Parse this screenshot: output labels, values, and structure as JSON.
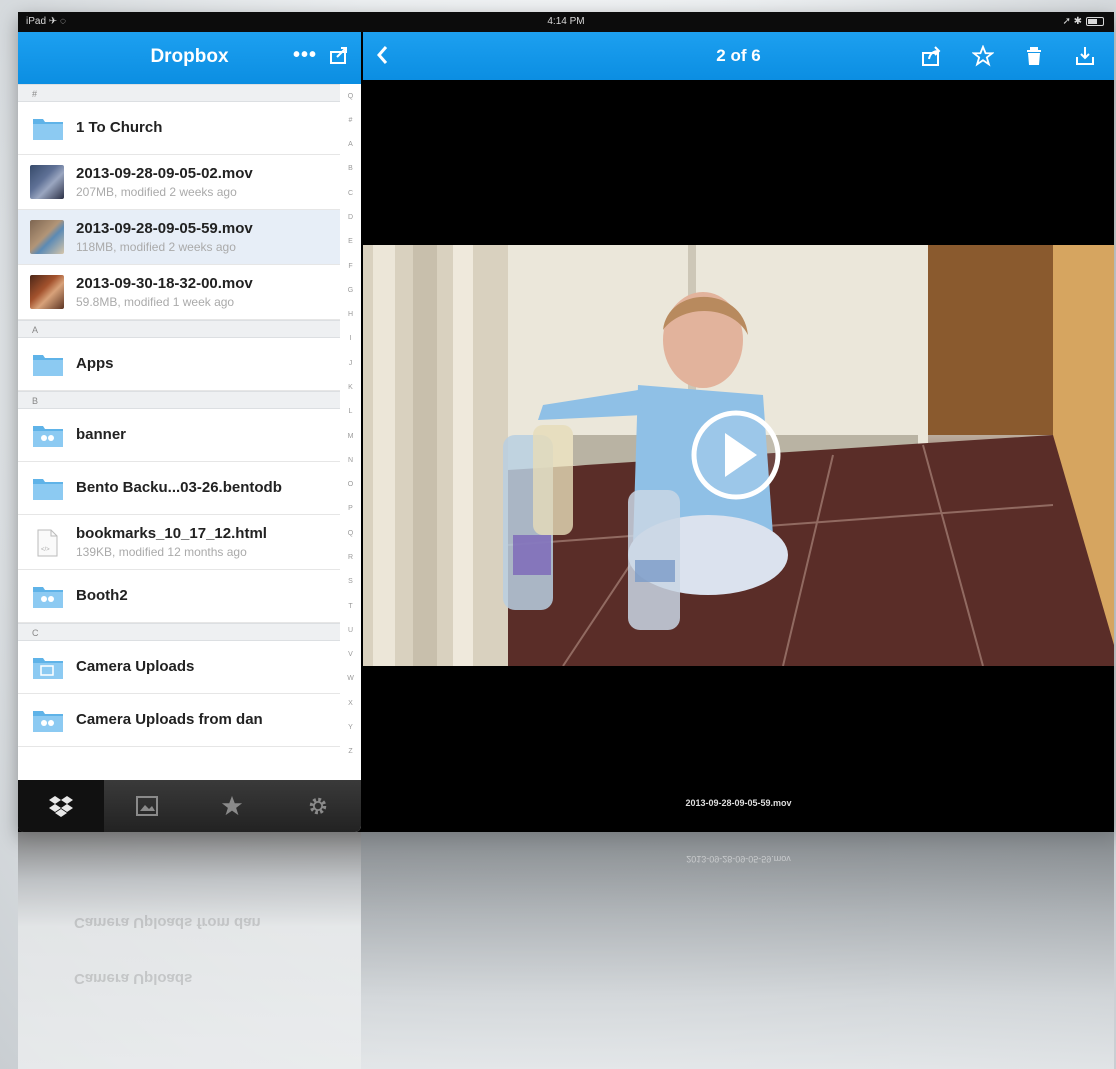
{
  "status_bar": {
    "carrier": "iPad ✈ ◌",
    "time": "4:14 PM",
    "right": "➚ ✱"
  },
  "sidebar": {
    "title": "Dropbox",
    "more_label": "•••",
    "sections": [
      {
        "header": "#",
        "items": [
          {
            "type": "folder",
            "name": "1 To Church",
            "meta": ""
          },
          {
            "type": "video",
            "name": "2013-09-28-09-05-02.mov",
            "meta": "207MB, modified 2 weeks ago"
          },
          {
            "type": "video",
            "name": "2013-09-28-09-05-59.mov",
            "meta": "118MB, modified 2 weeks ago",
            "selected": true
          },
          {
            "type": "video",
            "name": "2013-09-30-18-32-00.mov",
            "meta": "59.8MB, modified 1 week ago"
          }
        ]
      },
      {
        "header": "A",
        "items": [
          {
            "type": "folder",
            "name": "Apps",
            "meta": ""
          }
        ]
      },
      {
        "header": "B",
        "items": [
          {
            "type": "shared-folder",
            "name": "banner",
            "meta": ""
          },
          {
            "type": "folder",
            "name": "Bento Backu...03-26.bentodb",
            "meta": ""
          },
          {
            "type": "file",
            "name": "bookmarks_10_17_12.html",
            "meta": "139KB, modified 12 months ago"
          },
          {
            "type": "shared-folder",
            "name": "Booth2",
            "meta": ""
          }
        ]
      },
      {
        "header": "C",
        "items": [
          {
            "type": "photo-folder",
            "name": "Camera Uploads",
            "meta": ""
          },
          {
            "type": "shared-folder",
            "name": "Camera Uploads from dan",
            "meta": ""
          }
        ]
      }
    ],
    "index_letters": [
      "Q",
      "#",
      "A",
      "B",
      "C",
      "D",
      "E",
      "F",
      "G",
      "H",
      "I",
      "J",
      "K",
      "L",
      "M",
      "N",
      "O",
      "P",
      "Q",
      "R",
      "S",
      "T",
      "U",
      "V",
      "W",
      "X",
      "Y",
      "Z"
    ],
    "tabs": [
      {
        "name": "files",
        "icon": "dropbox-icon",
        "active": true
      },
      {
        "name": "photos",
        "icon": "photos-icon",
        "active": false
      },
      {
        "name": "favorites",
        "icon": "star-icon",
        "active": false
      },
      {
        "name": "settings",
        "icon": "gear-icon",
        "active": false
      }
    ]
  },
  "viewer": {
    "title": "2 of 6",
    "filename": "2013-09-28-09-05-59.mov",
    "actions": [
      "share-icon",
      "star-icon",
      "trash-icon",
      "export-icon"
    ]
  },
  "reflection": {
    "rows": [
      "Camera Uploads from dan",
      "Camera Uploads"
    ],
    "filename": "2013-09-28-09-05-59.mov"
  },
  "colors": {
    "accent": "#0b8ee2",
    "selected_row": "#e7eef7"
  }
}
